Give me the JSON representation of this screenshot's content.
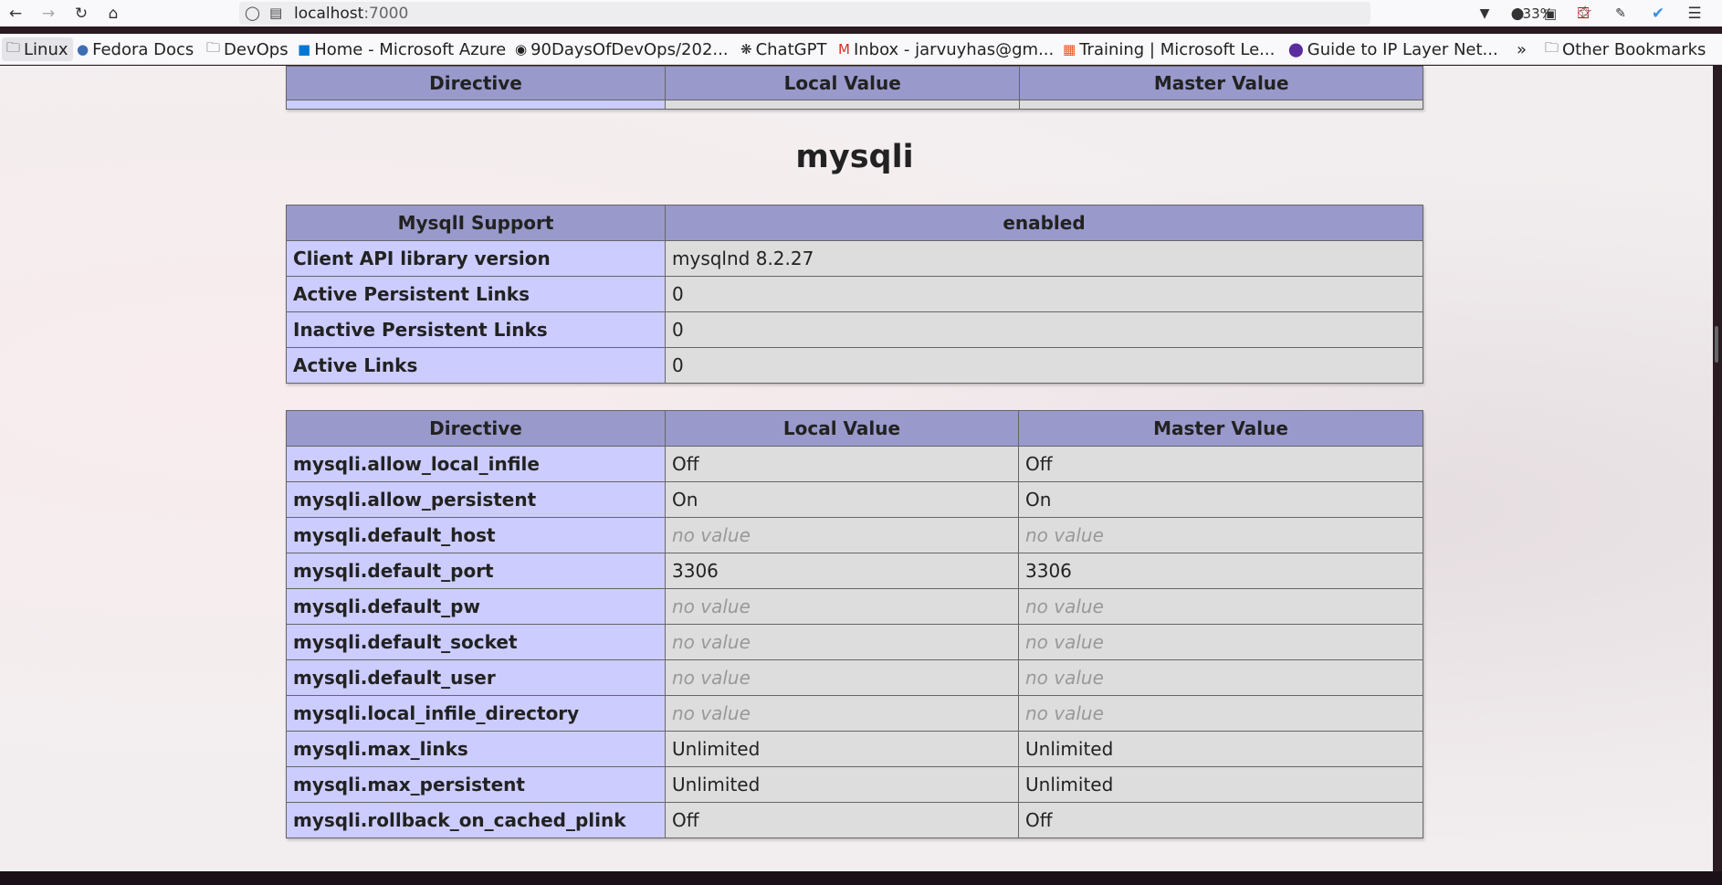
{
  "toolbar": {
    "url_host": "localhost",
    "url_port": ":7000",
    "zoom": "133%",
    "icons": [
      "back-icon",
      "forward-icon",
      "reload-icon",
      "home-icon",
      "shield-icon",
      "page-info-icon",
      "star-icon",
      "pocket-icon",
      "extension-icon",
      "ublock-icon",
      "extensions-icon",
      "menu-icon"
    ]
  },
  "bookmarks": [
    {
      "label": "Linux",
      "icon": "folder-icon"
    },
    {
      "label": "Fedora Docs",
      "icon": "fedora-icon"
    },
    {
      "label": "DevOps",
      "icon": "folder-icon"
    },
    {
      "label": "Home - Microsoft Azure",
      "icon": "azure-icon"
    },
    {
      "label": "90DaysOfDevOps/202...",
      "icon": "github-icon"
    },
    {
      "label": "ChatGPT",
      "icon": "openai-icon"
    },
    {
      "label": "Inbox - jarvuyhas@gm...",
      "icon": "gmail-icon"
    },
    {
      "label": "Training | Microsoft Le...",
      "icon": "microsoft-icon"
    },
    {
      "label": "Guide to IP Layer Net...",
      "icon": "circle-icon"
    },
    {
      "label": "Other Bookmarks",
      "icon": "folder-icon"
    }
  ],
  "top_table": {
    "headers": [
      "Directive",
      "Local Value",
      "Master Value"
    ]
  },
  "section": {
    "title": "mysqli"
  },
  "support_table": {
    "headers": [
      "MysqlI Support",
      "enabled"
    ],
    "rows": [
      {
        "name": "Client API library version",
        "value": "mysqlnd 8.2.27"
      },
      {
        "name": "Active Persistent Links",
        "value": "0"
      },
      {
        "name": "Inactive Persistent Links",
        "value": "0"
      },
      {
        "name": "Active Links",
        "value": "0"
      }
    ]
  },
  "directive_table": {
    "headers": [
      "Directive",
      "Local Value",
      "Master Value"
    ],
    "rows": [
      {
        "name": "mysqli.allow_local_infile",
        "local": "Off",
        "master": "Off",
        "novalue": false
      },
      {
        "name": "mysqli.allow_persistent",
        "local": "On",
        "master": "On",
        "novalue": false
      },
      {
        "name": "mysqli.default_host",
        "local": "no value",
        "master": "no value",
        "novalue": true
      },
      {
        "name": "mysqli.default_port",
        "local": "3306",
        "master": "3306",
        "novalue": false
      },
      {
        "name": "mysqli.default_pw",
        "local": "no value",
        "master": "no value",
        "novalue": true
      },
      {
        "name": "mysqli.default_socket",
        "local": "no value",
        "master": "no value",
        "novalue": true
      },
      {
        "name": "mysqli.default_user",
        "local": "no value",
        "master": "no value",
        "novalue": true
      },
      {
        "name": "mysqli.local_infile_directory",
        "local": "no value",
        "master": "no value",
        "novalue": true
      },
      {
        "name": "mysqli.max_links",
        "local": "Unlimited",
        "master": "Unlimited",
        "novalue": false
      },
      {
        "name": "mysqli.max_persistent",
        "local": "Unlimited",
        "master": "Unlimited",
        "novalue": false
      },
      {
        "name": "mysqli.rollback_on_cached_plink",
        "local": "Off",
        "master": "Off",
        "novalue": false
      }
    ]
  }
}
